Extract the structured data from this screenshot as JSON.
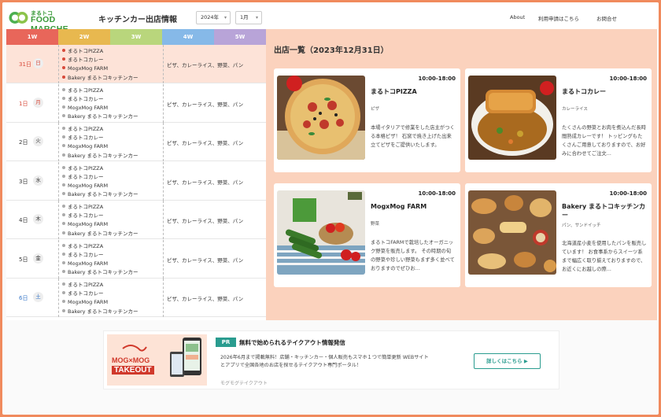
{
  "header": {
    "logo_small": "まるトコ",
    "logo_big": "FOOD MARCHE",
    "title": "キッチンカー出店情報",
    "year_select": "2024年",
    "month_select": "1月",
    "nav": [
      "About",
      "利用申請はこちら",
      "お問合せ"
    ]
  },
  "calendar": {
    "weeks": [
      {
        "label": "1W",
        "color": "#e8665a"
      },
      {
        "label": "2W",
        "color": "#e8b84f"
      },
      {
        "label": "3W",
        "color": "#b9d67c"
      },
      {
        "label": "4W",
        "color": "#86b9e8"
      },
      {
        "label": "5W",
        "color": "#b8a4d8"
      }
    ],
    "rows": [
      {
        "day": "31日",
        "dow": "日",
        "num_color": "#d84a3a",
        "dow_color": "#d84a3a",
        "selected": true,
        "shops": [
          "まるトコPIZZA",
          "まるトコカレー",
          "MogxMog FARM",
          "Bakery まるトコキッチンカー"
        ],
        "cats": "ピザ、カレーライス、野菜、パン"
      },
      {
        "day": "1日",
        "dow": "月",
        "num_color": "#d84a3a",
        "dow_color": "#d84a3a",
        "selected": false,
        "shops": [
          "まるトコPIZZA",
          "まるトコカレー",
          "MogxMog FARM",
          "Bakery まるトコキッチンカー"
        ],
        "cats": "ピザ、カレーライス、野菜、パン"
      },
      {
        "day": "2日",
        "dow": "火",
        "num_color": "#333333",
        "dow_color": "#333333",
        "selected": false,
        "shops": [
          "まるトコPIZZA",
          "まるトコカレー",
          "MogxMog FARM",
          "Bakery まるトコキッチンカー"
        ],
        "cats": "ピザ、カレーライス、野菜、パン"
      },
      {
        "day": "3日",
        "dow": "水",
        "num_color": "#333333",
        "dow_color": "#333333",
        "selected": false,
        "shops": [
          "まるトコPIZZA",
          "まるトコカレー",
          "MogxMog FARM",
          "Bakery まるトコキッチンカー"
        ],
        "cats": "ピザ、カレーライス、野菜、パン"
      },
      {
        "day": "4日",
        "dow": "木",
        "num_color": "#333333",
        "dow_color": "#333333",
        "selected": false,
        "shops": [
          "まるトコPIZZA",
          "まるトコカレー",
          "MogxMog FARM",
          "Bakery まるトコキッチンカー"
        ],
        "cats": "ピザ、カレーライス、野菜、パン"
      },
      {
        "day": "5日",
        "dow": "金",
        "num_color": "#333333",
        "dow_color": "#333333",
        "selected": false,
        "shops": [
          "まるトコPIZZA",
          "まるトコカレー",
          "MogxMog FARM",
          "Bakery まるトコキッチンカー"
        ],
        "cats": "ピザ、カレーライス、野菜、パン"
      },
      {
        "day": "6日",
        "dow": "土",
        "num_color": "#3a78c8",
        "dow_color": "#3a78c8",
        "selected": false,
        "shops": [
          "まるトコPIZZA",
          "まるトコカレー",
          "MogxMog FARM",
          "Bakery まるトコキッチンカー"
        ],
        "cats": "ピザ、カレーライス、野菜、パン"
      }
    ]
  },
  "panel": {
    "title": "出店一覧（2023年12月31日）",
    "cards": [
      {
        "time": "10:00-18:00",
        "name": "まるトコPIZZA",
        "category": "ピザ",
        "desc": "本場イタリアで修業をした店主がつくる本格ピザ！ 石窯で焼き上げた出来立てピザをご提供いたします。",
        "image": "pizza"
      },
      {
        "time": "10:00-18:00",
        "name": "まるトコカレー",
        "category": "カレーライス",
        "desc": "たくさんの野菜とお肉を煮込んだ長時間熟成カレーです！ トッピングもたくさんご用意しておりますので、お好みに合わせてご注文…",
        "image": "curry"
      },
      {
        "time": "10:00-18:00",
        "name": "MogxMog FARM",
        "category": "野菜",
        "desc": "まるトコFARMで栽培したオーガニック野菜を販売します。 その時期の旬の野菜や珍しい野菜もまず多く並べておりますのでぜひお…",
        "image": "vegetables"
      },
      {
        "time": "10:00-18:00",
        "name": "Bakery まるトコキッチンカー",
        "category": "パン、サンドイッチ",
        "desc": "北海道産小麦を使用したパンを販売しています！ お食事系からスイーツ系まで幅広く取り揃えておりますので、お近くにお越しの際…",
        "image": "bread"
      }
    ]
  },
  "pr": {
    "tag": "PR",
    "headline": "無料で始められるテイクアウト情報発信",
    "text": "2026年6月まで掲載無料！店舗・キッチンカー・個人販売もスマホ１つで簡単更新 WEBサイトとアプリで全国各地のお店を探せるテイクアウト専門ポータル！",
    "source": "モグモグテイクアウト",
    "button": "詳しくはこちら ▶",
    "image_logo_1": "MOG×MOG",
    "image_logo_2": "TAKEOUT"
  }
}
